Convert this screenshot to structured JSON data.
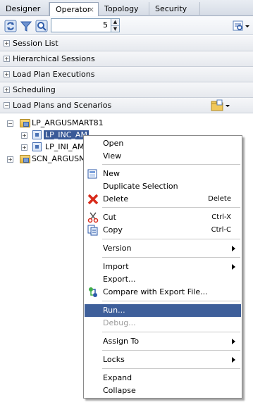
{
  "tabs": [
    {
      "label": "Designer",
      "active": false
    },
    {
      "label": "Operator",
      "active": true,
      "close": "×"
    },
    {
      "label": "Topology",
      "active": false
    },
    {
      "label": "Security",
      "active": false
    }
  ],
  "toolbar": {
    "refresh_icon": "refresh-icon",
    "filter_icon": "filter-icon",
    "search_icon": "find-icon",
    "spinner_value": "5",
    "view_menu_icon": "view-menu-icon"
  },
  "sections": [
    {
      "label": "Session List",
      "toggle": "+"
    },
    {
      "label": "Hierarchical Sessions",
      "toggle": "+"
    },
    {
      "label": "Load Plan Executions",
      "toggle": "+"
    },
    {
      "label": "Scheduling",
      "toggle": "+"
    },
    {
      "label": "Load Plans and Scenarios",
      "toggle": "−"
    }
  ],
  "tree": {
    "root": {
      "label": "LP_ARGUSMART81",
      "toggle": "−"
    },
    "child1": {
      "label": "LP_INC_AM",
      "toggle": "+"
    },
    "child2": {
      "label": "LP_INI_AM",
      "toggle": "+"
    },
    "scenario": {
      "label": "SCN_ARGUSMA",
      "toggle": "+"
    }
  },
  "context_menu": {
    "open": "Open",
    "view": "View",
    "new": "New",
    "duplicate": "Duplicate Selection",
    "delete": "Delete",
    "delete_shortcut": "Delete",
    "cut": "Cut",
    "cut_shortcut": "Ctrl-X",
    "copy": "Copy",
    "copy_shortcut": "Ctrl-C",
    "version": "Version",
    "import": "Import",
    "export": "Export...",
    "compare": "Compare with Export File...",
    "run": "Run...",
    "debug": "Debug...",
    "assign_to": "Assign To",
    "locks": "Locks",
    "expand": "Expand",
    "collapse": "Collapse"
  },
  "colors": {
    "selection": "#3e5f9a",
    "tab_border": "#9aa7ba"
  }
}
